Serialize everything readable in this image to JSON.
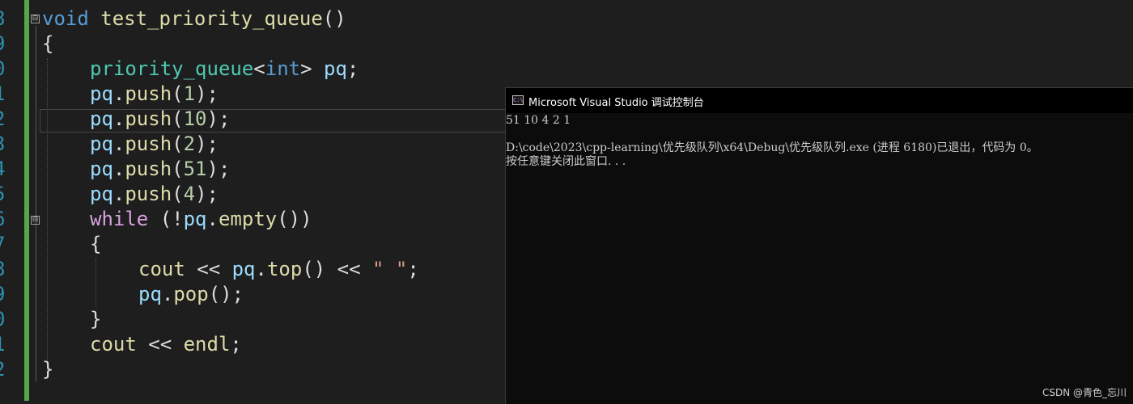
{
  "editor": {
    "line_number_digits": [
      "8",
      "9",
      "0",
      "1",
      "2",
      "3",
      "4",
      "5",
      "6",
      "7",
      "8",
      "9",
      "0",
      "1",
      "2"
    ],
    "code": {
      "l1": {
        "kw": "void",
        "fn": "test_priority_queue",
        "rest": "()"
      },
      "l2": {
        "text": "{"
      },
      "l3": {
        "type": "priority_queue",
        "lt": "<",
        "int": "int",
        "gt": ">",
        "var": "pq",
        "end": ";"
      },
      "l4": {
        "var": "pq",
        "dot": ".",
        "fn": "push",
        "open": "(",
        "num": "1",
        "close": ");"
      },
      "l5": {
        "var": "pq",
        "dot": ".",
        "fn": "push",
        "open": "(",
        "num": "10",
        "close": ");"
      },
      "l6": {
        "var": "pq",
        "dot": ".",
        "fn": "push",
        "open": "(",
        "num": "2",
        "close": ");"
      },
      "l7": {
        "var": "pq",
        "dot": ".",
        "fn": "push",
        "open": "(",
        "num": "51",
        "close": ");"
      },
      "l8": {
        "var": "pq",
        "dot": ".",
        "fn": "push",
        "open": "(",
        "num": "4",
        "close": ");"
      },
      "l9": {
        "kw": "while",
        "open": " (!",
        "var": "pq",
        "dot": ".",
        "fn": "empty",
        "close": "())"
      },
      "l10": {
        "text": "{"
      },
      "l11": {
        "obj": "cout",
        "op1": " << ",
        "var": "pq",
        "dot": ".",
        "fn": "top",
        "paren": "()",
        "op2": " << ",
        "str": "\" \"",
        "end": ";"
      },
      "l12": {
        "var": "pq",
        "dot": ".",
        "fn": "pop",
        "close": "();"
      },
      "l13": {
        "text": "}"
      },
      "l14": {
        "obj": "cout",
        "op": " << ",
        "fn": "endl",
        "end": ";"
      },
      "l15": {
        "text": "}"
      }
    },
    "collapse_symbol": "⊟"
  },
  "console": {
    "title": "Microsoft Visual Studio 调试控制台",
    "icon_text": "C:\\",
    "icon": "console-app-icon",
    "lines": [
      "51 10 4 2 1",
      "",
      "D:\\code\\2023\\cpp-learning\\优先级队列\\x64\\Debug\\优先级队列.exe (进程 6180)已退出，代码为 0。",
      "按任意键关闭此窗口. . ."
    ]
  },
  "watermark": "CSDN @青色_忘川",
  "colors": {
    "keyword": "#569cd6",
    "control": "#d8a0df",
    "function": "#dcdcaa",
    "type": "#4ec9b0",
    "variable": "#9cdcfe",
    "number": "#b5cea8",
    "string": "#d69d85",
    "changed_bar": "#57a64a"
  }
}
